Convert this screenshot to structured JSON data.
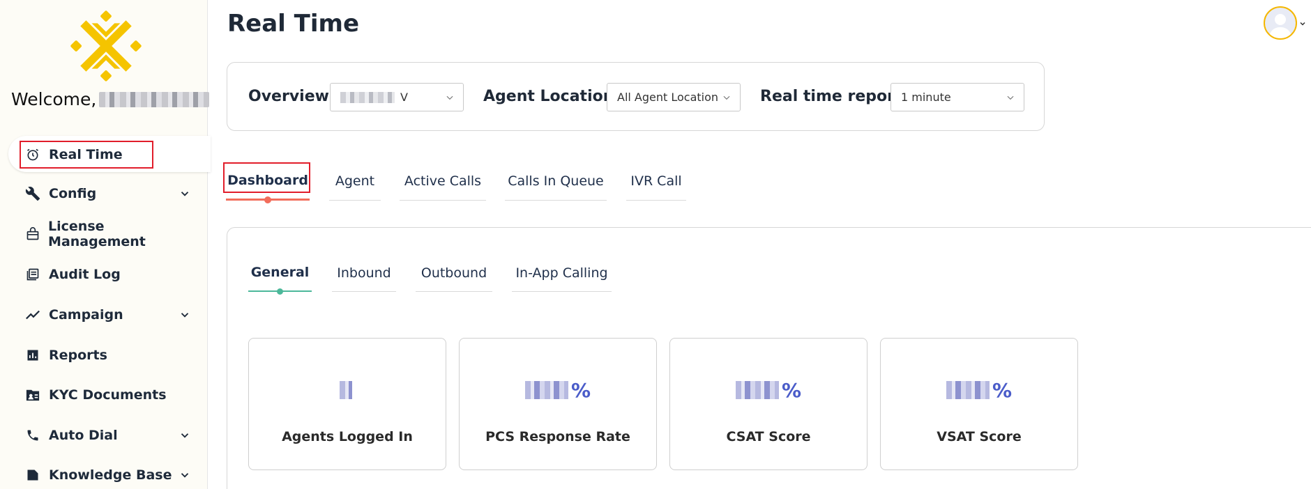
{
  "sidebar": {
    "welcome_prefix": "Welcome,",
    "items": [
      {
        "label": "Real Time",
        "icon": "alarm-clock-icon",
        "expandable": false
      },
      {
        "label": "Config",
        "icon": "wrench-icon",
        "expandable": true
      },
      {
        "label": "License Management",
        "icon": "license-icon",
        "expandable": false
      },
      {
        "label": "Audit Log",
        "icon": "audit-log-icon",
        "expandable": false
      },
      {
        "label": "Campaign",
        "icon": "trend-line-icon",
        "expandable": true
      },
      {
        "label": "Reports",
        "icon": "bar-chart-icon",
        "expandable": false
      },
      {
        "label": "KYC Documents",
        "icon": "id-folder-icon",
        "expandable": false
      },
      {
        "label": "Auto Dial",
        "icon": "phone-icon",
        "expandable": true
      },
      {
        "label": "Knowledge Base",
        "icon": "document-icon",
        "expandable": true
      }
    ]
  },
  "header": {
    "title": "Real Time"
  },
  "filters": {
    "overview_label": "Overview",
    "overview_value_suffix": "V",
    "agent_location_label": "Agent Location",
    "agent_location_value": "All Agent Location",
    "report_label": "Real time report",
    "report_value": "1 minute"
  },
  "tabs": [
    "Dashboard",
    "Agent",
    "Active Calls",
    "Calls In Queue",
    "IVR Call"
  ],
  "subtabs": [
    "General",
    "Inbound",
    "Outbound",
    "In-App Calling"
  ],
  "cards": [
    {
      "label": "Agents Logged In",
      "suffix": ""
    },
    {
      "label": "PCS Response Rate",
      "suffix": "%"
    },
    {
      "label": "CSAT Score",
      "suffix": "%"
    },
    {
      "label": "VSAT Score",
      "suffix": "%"
    }
  ],
  "colors": {
    "accent_tab": "#f26d5b",
    "accent_subtab": "#4cb89a",
    "highlight_box": "#e11d2a",
    "metric_value": "#4a5cc9",
    "logo": "#f5c400"
  }
}
